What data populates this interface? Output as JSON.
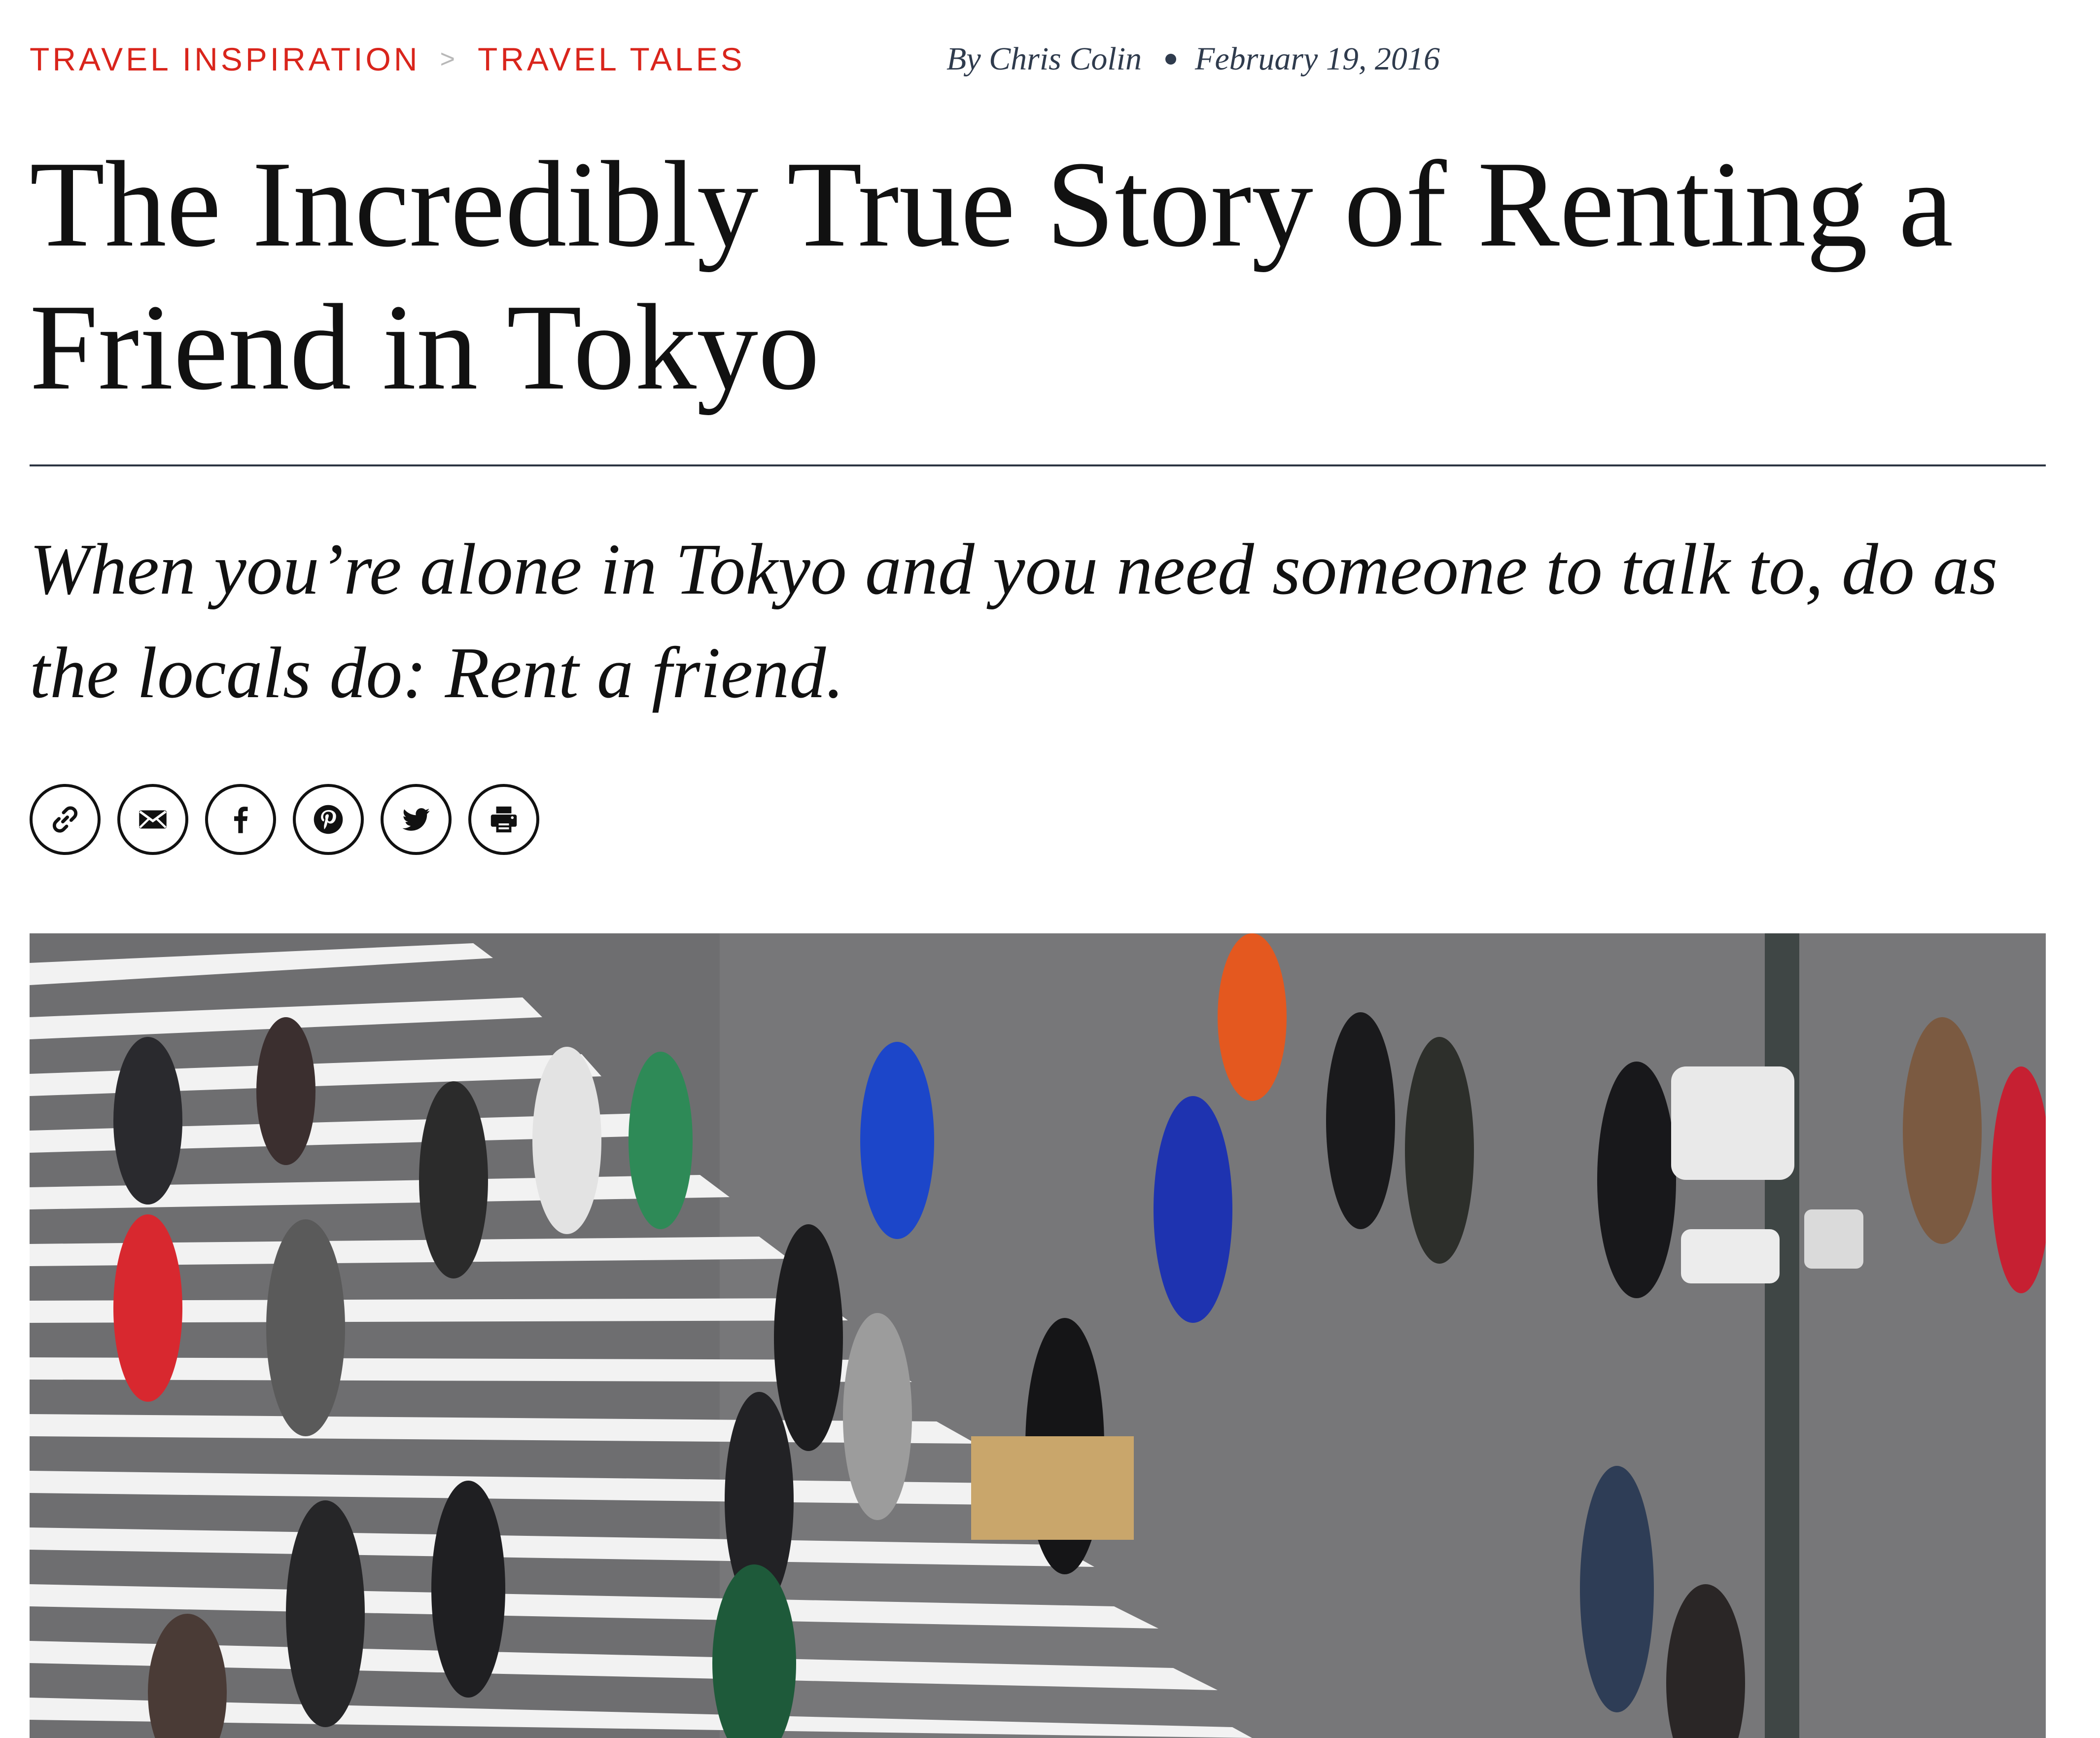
{
  "breadcrumb": {
    "items": [
      "TRAVEL INSPIRATION",
      "TRAVEL TALES"
    ],
    "separator": ">"
  },
  "byline": {
    "author": "By Chris Colin",
    "date": "February 19, 2016"
  },
  "article": {
    "title": "The Incredibly True Story of Renting a Friend in Tokyo",
    "dek": "When you’re alone in Tokyo and you need someone to talk to, do as the locals do: Rent a friend."
  },
  "share": {
    "buttons": [
      "link-icon",
      "email-icon",
      "facebook-icon",
      "pinterest-icon",
      "twitter-icon",
      "print-icon"
    ]
  },
  "hero_image": {
    "subject": "crowded-pedestrian-crosswalk-photo"
  },
  "colors": {
    "accent": "#d9251c",
    "byline": "#2f3b4d",
    "text": "#111111",
    "rule": "#2c3542"
  }
}
